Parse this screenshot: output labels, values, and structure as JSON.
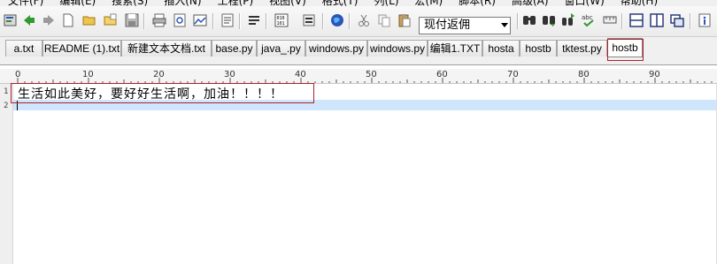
{
  "menu": {
    "items": [
      "文件(F)",
      "编辑(E)",
      "搜索(S)",
      "插入(N)",
      "工程(P)",
      "视图(V)",
      "格式(T)",
      "列(L)",
      "宏(M)",
      "脚本(R)",
      "高级(A)",
      "窗口(W)",
      "帮助(H)"
    ]
  },
  "toolbar": {
    "combo_value": "现付返佣",
    "icons": [
      "app-icon",
      "back-arrow-icon",
      "forward-arrow-icon",
      "new-file-icon",
      "open-folder-icon",
      "open-file-icon",
      "save-icon",
      "print-icon",
      "print-preview-icon",
      "image-icon",
      "document-icon",
      "list-icon",
      "binary-icon",
      "format-icon",
      "globe-icon",
      "cut-icon",
      "copy-icon",
      "paste-icon",
      "find-icon",
      "find-next-icon",
      "replace-icon",
      "spell-check-icon",
      "ruler-toggle-icon",
      "split-horizontal-icon",
      "split-vertical-icon",
      "window-icon",
      "info-icon"
    ],
    "accent": "#2a56b8"
  },
  "tabs": [
    {
      "label": "a.txt",
      "active": false
    },
    {
      "label": "README (1).txt",
      "active": false
    },
    {
      "label": "新建文本文档.txt",
      "active": false
    },
    {
      "label": "base.py",
      "active": false
    },
    {
      "label": "java_.py",
      "active": false
    },
    {
      "label": "windows.py",
      "active": false
    },
    {
      "label": "windows.py",
      "active": false
    },
    {
      "label": "编辑1.TXT",
      "active": false
    },
    {
      "label": "hosta",
      "active": false
    },
    {
      "label": "hostb",
      "active": false
    },
    {
      "label": "tktest.py",
      "active": false
    },
    {
      "label": "hostb",
      "active": true
    }
  ],
  "ruler": {
    "labels": [
      "0",
      "10",
      "20",
      "30",
      "40",
      "50",
      "60",
      "70",
      "80",
      "90"
    ]
  },
  "editor": {
    "line_numbers": [
      "1",
      "2"
    ],
    "lines": [
      "生活如此美好，要好好生活啊，加油！！！！",
      ""
    ],
    "current_line": 2,
    "highlight_color": "#cfe5fb",
    "annotation_color": "#b0202a"
  }
}
